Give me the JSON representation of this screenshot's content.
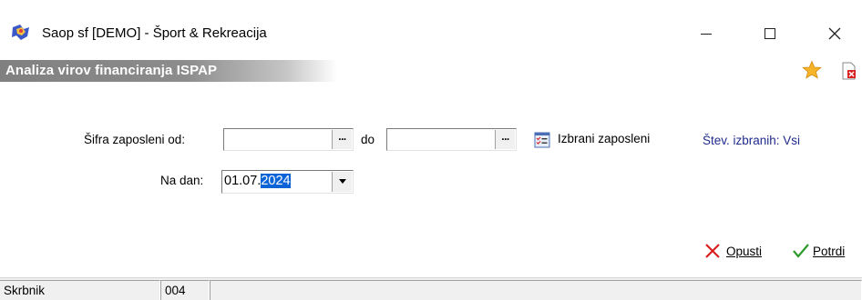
{
  "window": {
    "title": "Saop sf [DEMO] - Šport & Rekreacija",
    "app_icon": "saop-app-icon",
    "controls": [
      "minimize-icon",
      "maximize-icon",
      "close-icon"
    ]
  },
  "header": {
    "title": "Analiza virov financiranja ISPAP",
    "icons": [
      "star-icon",
      "close-document-icon"
    ]
  },
  "form": {
    "employee_from_label": "Šifra zaposleni od:",
    "employee_from_value": "",
    "employee_to_label": "do",
    "employee_to_value": "",
    "browse_button_label": "...",
    "selected_employees_label": "Izbrani zaposleni",
    "selected_count_label": "Štev. izbranih: Vsi",
    "date_label": "Na dan:",
    "date_prefix": "01.07.",
    "date_selected": "2024"
  },
  "actions": {
    "cancel_label": "Opusti",
    "confirm_label": "Potrdi"
  },
  "statusbar": {
    "user": "Skrbnik",
    "code": "004",
    "extra": ""
  },
  "colors": {
    "header_gradient_start": "#808080",
    "link_text": "#1f2b8c",
    "selection": "#0a64d8",
    "cancel_icon": "#d92020",
    "confirm_icon": "#2e9b2e",
    "star": "#f5a623"
  }
}
